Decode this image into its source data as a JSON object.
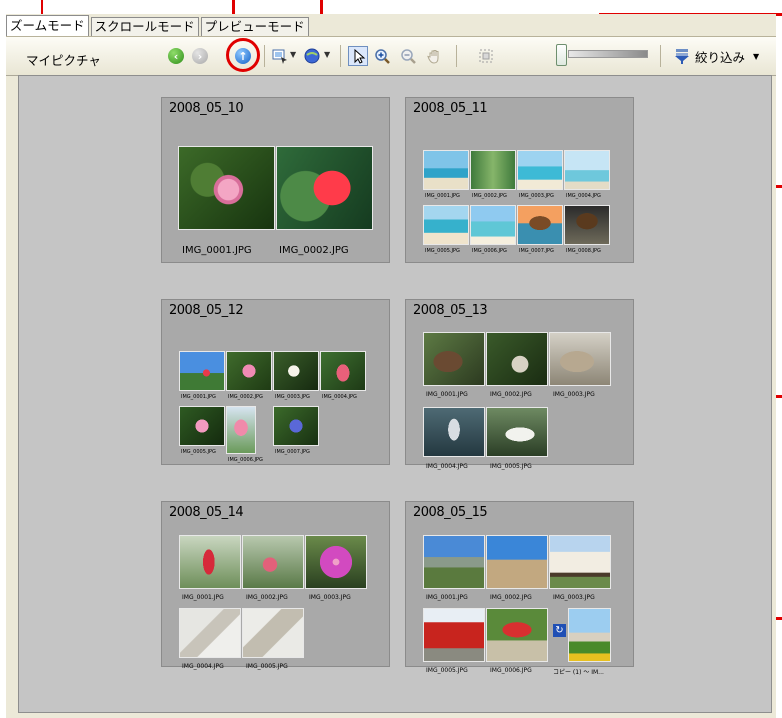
{
  "tabs": [
    {
      "label": "ズームモード",
      "active": true
    },
    {
      "label": "スクロールモード",
      "active": false
    },
    {
      "label": "プレビューモード",
      "active": false
    }
  ],
  "toolbar": {
    "title": "マイピクチャ",
    "filter_label": "絞り込み",
    "icons": [
      "back-icon",
      "forward-icon",
      "up-icon",
      "select-view-icon",
      "globe-icon",
      "pointer-icon",
      "zoom-in-icon",
      "zoom-out-icon",
      "hand-icon",
      "fit-icon"
    ]
  },
  "groups": [
    {
      "title": "2008_05_10",
      "captions": [
        "IMG_0001.JPG",
        "IMG_0002.JPG"
      ]
    },
    {
      "title": "2008_05_11",
      "captions": [
        "IMG_0001.JPG",
        "IMG_0002.JPG",
        "IMG_0003.JPG",
        "IMG_0004.JPG",
        "IMG_0005.JPG",
        "IMG_0006.JPG",
        "IMG_0007.JPG",
        "IMG_0008.JPG"
      ]
    },
    {
      "title": "2008_05_12",
      "captions": [
        "IMG_0001.JPG",
        "IMG_0002.JPG",
        "IMG_0003.JPG",
        "IMG_0004.JPG",
        "IMG_0005.JPG",
        "IMG_0006.JPG",
        "IMG_0007.JPG"
      ]
    },
    {
      "title": "2008_05_13",
      "captions": [
        "IMG_0001.JPG",
        "IMG_0002.JPG",
        "IMG_0003.JPG",
        "IMG_0004.JPG",
        "IMG_0005.JPG"
      ]
    },
    {
      "title": "2008_05_14",
      "captions": [
        "IMG_0001.JPG",
        "IMG_0002.JPG",
        "IMG_0003.JPG",
        "IMG_0004.JPG",
        "IMG_0005.JPG"
      ]
    },
    {
      "title": "2008_05_15",
      "captions": [
        "IMG_0001.JPG",
        "IMG_0002.JPG",
        "IMG_0003.JPG",
        "IMG_0005.JPG",
        "IMG_0006.JPG",
        "コピー (1) ～ IM..."
      ]
    }
  ],
  "colors": {
    "callout": "#e00000",
    "panel": "#c5c5c5",
    "group": "#a9a9a9"
  }
}
